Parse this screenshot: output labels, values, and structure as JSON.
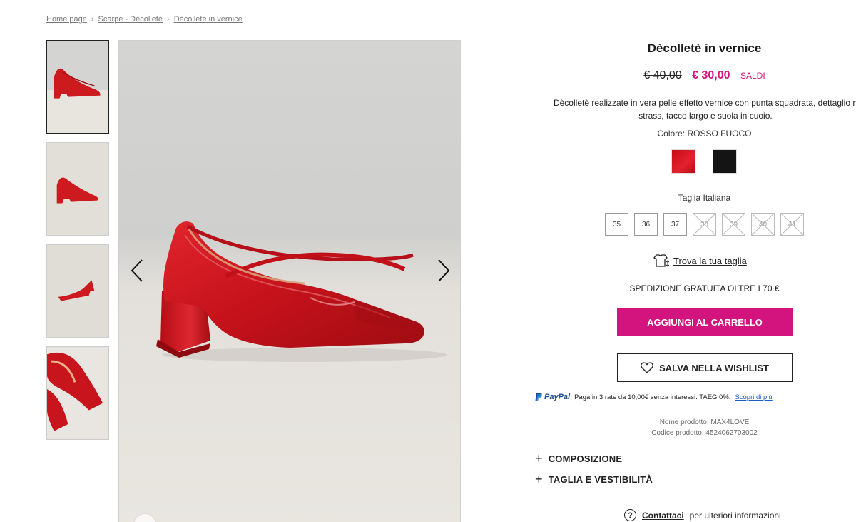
{
  "breadcrumb": {
    "items": [
      "Home page",
      "Scarpe - Décolleté",
      "Dècolletè in vernice"
    ]
  },
  "product": {
    "title": "Dècolletè in vernice",
    "old_price": "€ 40,00",
    "new_price": "€ 30,00",
    "sale_label": "SALDI",
    "description_line1": "Dècolletè realizzate in vera pelle effetto vernice con punta squadrata, dettaglio n",
    "description_line2": "strass, tacco largo e suola in cuoio.",
    "color_label": "Colore: ROSSO FUOCO",
    "colors": [
      "#d3141f",
      "#141414"
    ],
    "size_label": "Taglia Italiana",
    "sizes": [
      {
        "label": "35",
        "available": true
      },
      {
        "label": "36",
        "available": true
      },
      {
        "label": "37",
        "available": true
      },
      {
        "label": "38",
        "available": false
      },
      {
        "label": "39",
        "available": false
      },
      {
        "label": "40",
        "available": false
      },
      {
        "label": "41",
        "available": false
      }
    ],
    "find_size_label": "Trova la tua taglia",
    "shipping_text": "SPEDIZIONE GRATUITA OLTRE I 70 €",
    "add_to_cart_label": "AGGIUNGI AL CARRELLO",
    "wishlist_label": "SALVA NELLA WISHLIST",
    "paypal_brand": "PayPal",
    "paypal_text": "Paga in 3 rate da 10,00€ senza interessi. TAEG 0%.",
    "paypal_link": "Scopri di più",
    "name_meta": "Nome prodotto: MAX4LOVE",
    "code_meta": "Codice prodotto:  4524062703002",
    "accordion_composition": "COMPOSIZIONE",
    "accordion_fit": "TAGLIA E VESTIBILITÀ",
    "contact_link": "Contattaci",
    "contact_text": "per ulteriori informazioni"
  },
  "colors": {
    "accent": "#d4147e",
    "paypal_blue": "#1d4c94",
    "link_blue": "#1b5fc7"
  },
  "icons": [
    "chevron-left-icon",
    "chevron-right-icon",
    "heart-icon",
    "size-guide-icon",
    "question-icon",
    "plus-icon",
    "paypal-icon",
    "breadcrumb-chevron-icon"
  ]
}
